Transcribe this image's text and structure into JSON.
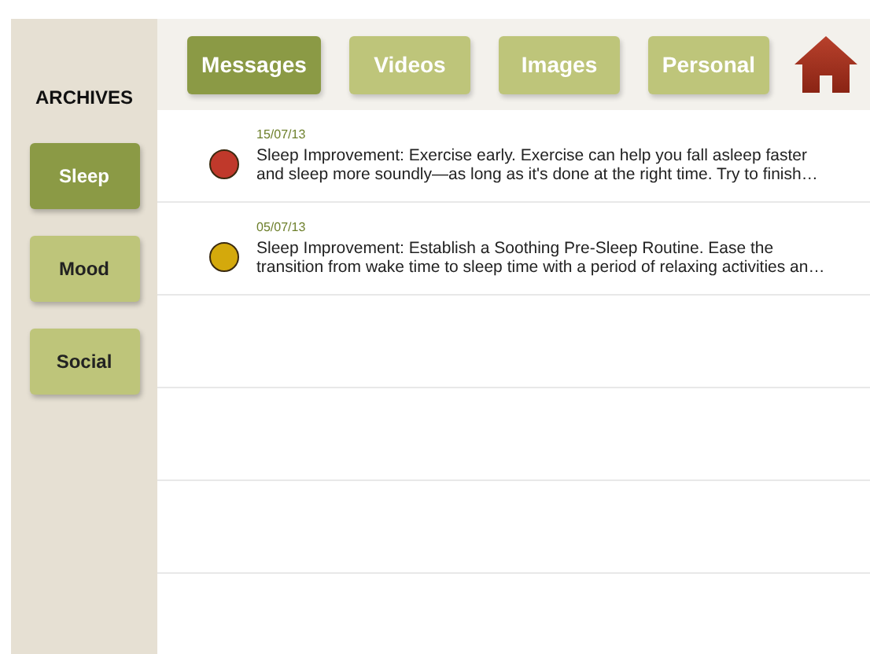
{
  "tabs": [
    {
      "label": "Messages",
      "selected": true
    },
    {
      "label": "Videos",
      "selected": false
    },
    {
      "label": "Images",
      "selected": false
    },
    {
      "label": "Personal",
      "selected": false
    }
  ],
  "sidebar": {
    "title": "ARCHIVES",
    "items": [
      {
        "label": "Sleep",
        "selected": true
      },
      {
        "label": "Mood",
        "selected": false
      },
      {
        "label": "Social",
        "selected": false
      }
    ]
  },
  "messages": [
    {
      "date": "15/07/13",
      "color": "#c0392b",
      "lines": [
        "Sleep Improvement: Exercise early. Exercise can help you fall asleep faster",
        "and sleep more soundly—as long as it's done at the right time. Try to finish…"
      ]
    },
    {
      "date": "05/07/13",
      "color": "#d4a90c",
      "lines": [
        "Sleep Improvement: Establish a Soothing Pre-Sleep Routine. Ease the",
        "transition from wake time to sleep time with a period of relaxing activities an…"
      ]
    }
  ]
}
